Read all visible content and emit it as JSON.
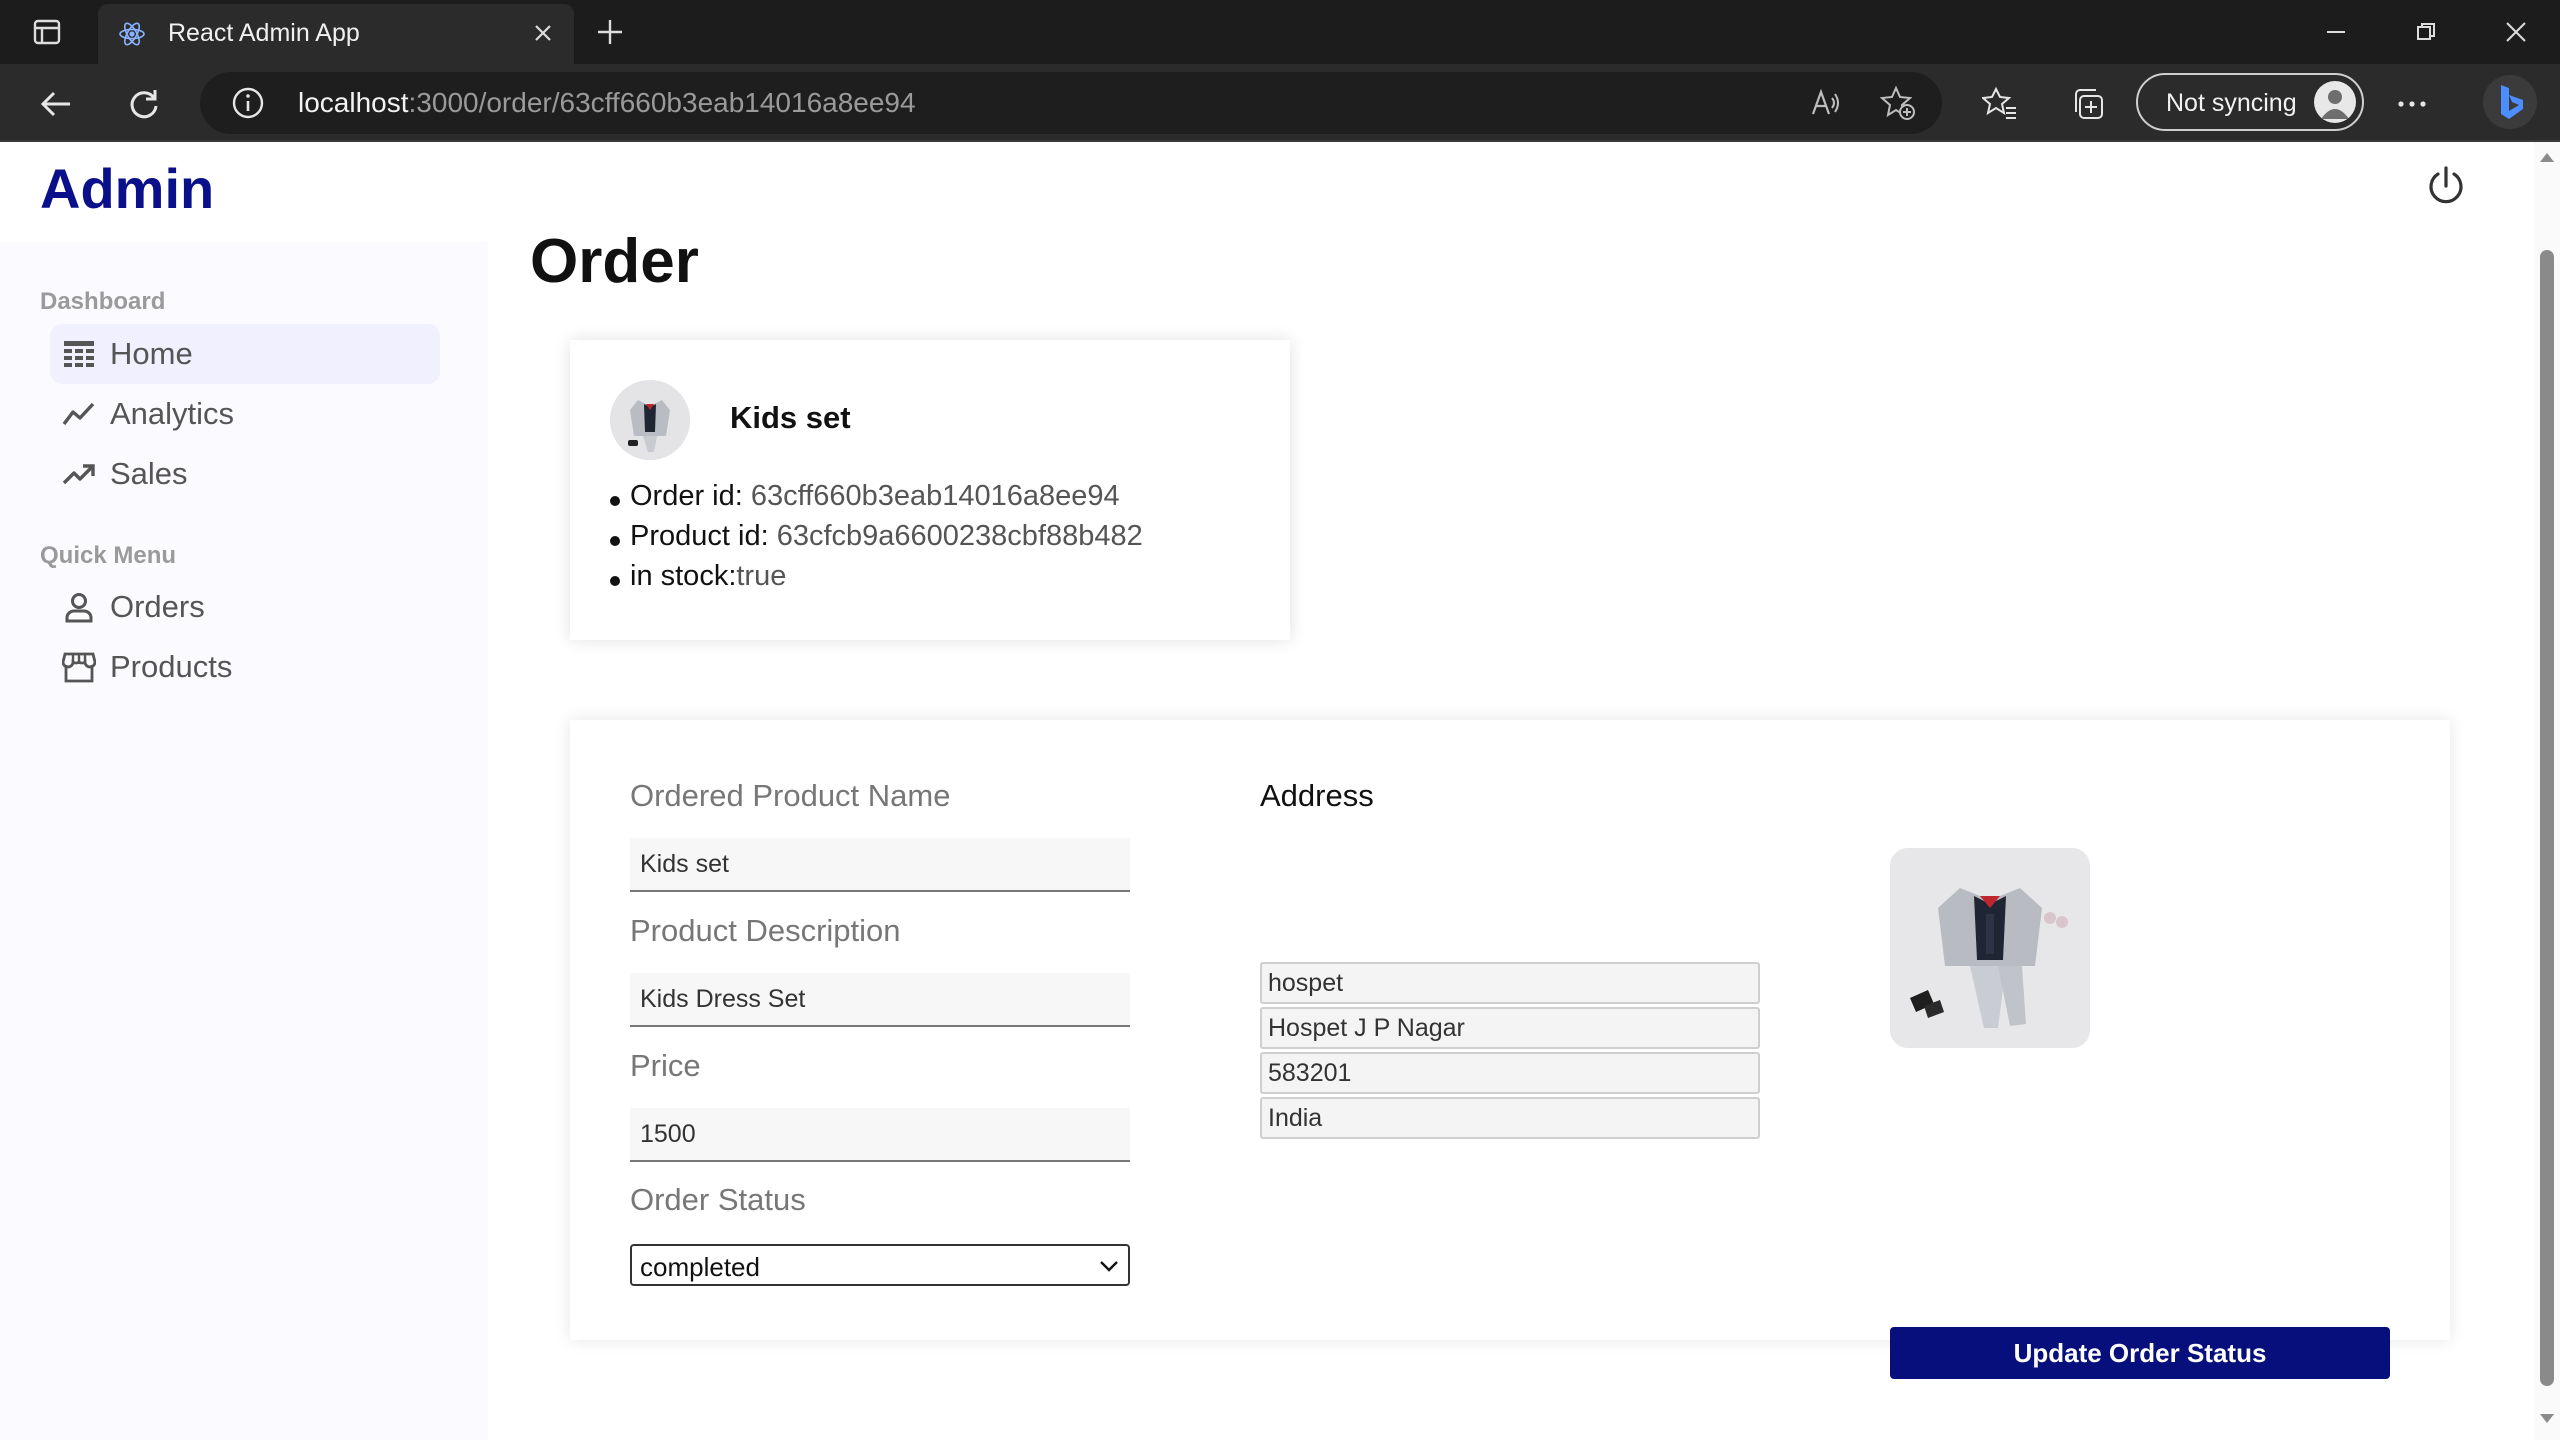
{
  "browser": {
    "tab_title": "React Admin App",
    "url_host": "localhost",
    "url_path": ":3000/order/63cff660b3eab14016a8ee94",
    "sync_label": "Not syncing"
  },
  "app": {
    "brand": "Admin",
    "page_title": "Order"
  },
  "sidebar": {
    "sections": [
      {
        "title": "Dashboard",
        "items": [
          {
            "label": "Home",
            "icon": "table-icon",
            "active": true
          },
          {
            "label": "Analytics",
            "icon": "line-chart-icon"
          },
          {
            "label": "Sales",
            "icon": "trending-up-icon"
          }
        ]
      },
      {
        "title": "Quick Menu",
        "items": [
          {
            "label": "Orders",
            "icon": "person-icon"
          },
          {
            "label": "Products",
            "icon": "storefront-icon"
          }
        ]
      }
    ]
  },
  "order_summary": {
    "product_name": "Kids set",
    "order_id_label": "Order id:",
    "order_id": "63cff660b3eab14016a8ee94",
    "product_id_label": "Product id:",
    "product_id": "63cfcb9a6600238cbf88b482",
    "in_stock_label": "in stock:",
    "in_stock": "true"
  },
  "form": {
    "product_name_label": "Ordered Product Name",
    "product_name_value": "Kids set",
    "description_label": "Product Description",
    "description_value": "Kids Dress Set",
    "price_label": "Price",
    "price_value": "1500",
    "status_label": "Order Status",
    "status_value": "completed",
    "address_label": "Address",
    "address_lines": [
      "hospet",
      "Hospet J P Nagar",
      "583201",
      "India"
    ],
    "submit_label": "Update Order Status"
  },
  "colors": {
    "brand": "#0a0f8a",
    "button": "#060f7c",
    "active_nav": "#f0f0ff"
  }
}
